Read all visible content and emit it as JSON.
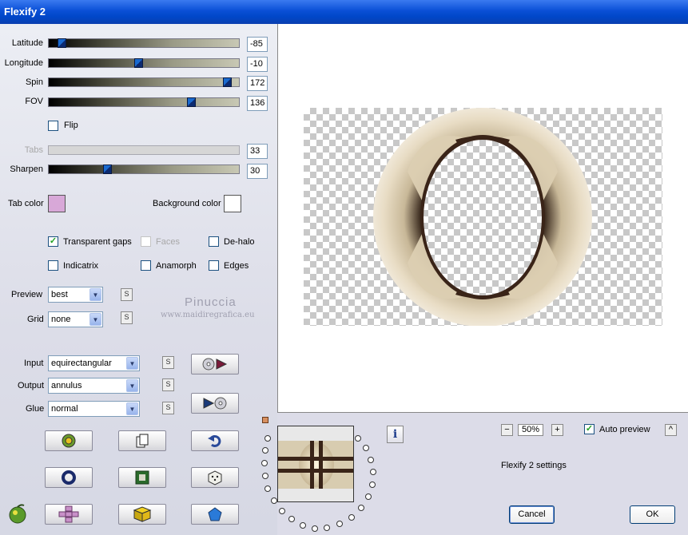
{
  "window": {
    "title": "Flexify 2"
  },
  "sliders": [
    {
      "id": "latitude",
      "label": "Latitude",
      "value": "-85",
      "fraction": 0.05,
      "enabled": true
    },
    {
      "id": "longitude",
      "label": "Longitude",
      "value": "-10",
      "fraction": 0.47,
      "enabled": true
    },
    {
      "id": "spin",
      "label": "Spin",
      "value": "172",
      "fraction": 0.96,
      "enabled": true
    },
    {
      "id": "fov",
      "label": "FOV",
      "value": "136",
      "fraction": 0.76,
      "enabled": true
    },
    {
      "id": "tabs",
      "label": "Tabs",
      "value": "33",
      "fraction": null,
      "enabled": false
    },
    {
      "id": "sharpen",
      "label": "Sharpen",
      "value": "30",
      "fraction": 0.3,
      "enabled": true
    }
  ],
  "flip": {
    "label": "Flip",
    "checked": false
  },
  "colors": {
    "tab_color_label": "Tab color",
    "tab_color": "#d8a8d8",
    "background_color_label": "Background color",
    "background_color": "#ffffff"
  },
  "options": {
    "transparent_gaps": {
      "label": "Transparent gaps",
      "checked": true
    },
    "faces": {
      "label": "Faces",
      "checked": false,
      "enabled": false
    },
    "de_halo": {
      "label": "De-halo",
      "checked": false
    },
    "indicatrix": {
      "label": "Indicatrix",
      "checked": false
    },
    "anamorph": {
      "label": "Anamorph",
      "checked": false
    },
    "edges": {
      "label": "Edges",
      "checked": false
    }
  },
  "selects": {
    "preview": {
      "label": "Preview",
      "value": "best"
    },
    "grid": {
      "label": "Grid",
      "value": "none"
    },
    "input": {
      "label": "Input",
      "value": "equirectangular"
    },
    "output": {
      "label": "Output",
      "value": "annulus"
    },
    "glue": {
      "label": "Glue",
      "value": "normal"
    }
  },
  "small_button_label": "S",
  "watermark": {
    "name": "Pinuccia",
    "site": "www.maidiregrafica.eu"
  },
  "zoom": {
    "value": "50%",
    "minus": "−",
    "plus": "+"
  },
  "auto_preview": {
    "label": "Auto preview",
    "checked": true
  },
  "collapse_label": "^",
  "settings_name": "Flexify 2 settings",
  "info_label": "i",
  "buttons": {
    "cancel": "Cancel",
    "ok": "OK"
  },
  "accent": {
    "title_bar": "#0a4fd6",
    "ring": "#d8ccb0",
    "ring_dark": "#3a2418"
  }
}
